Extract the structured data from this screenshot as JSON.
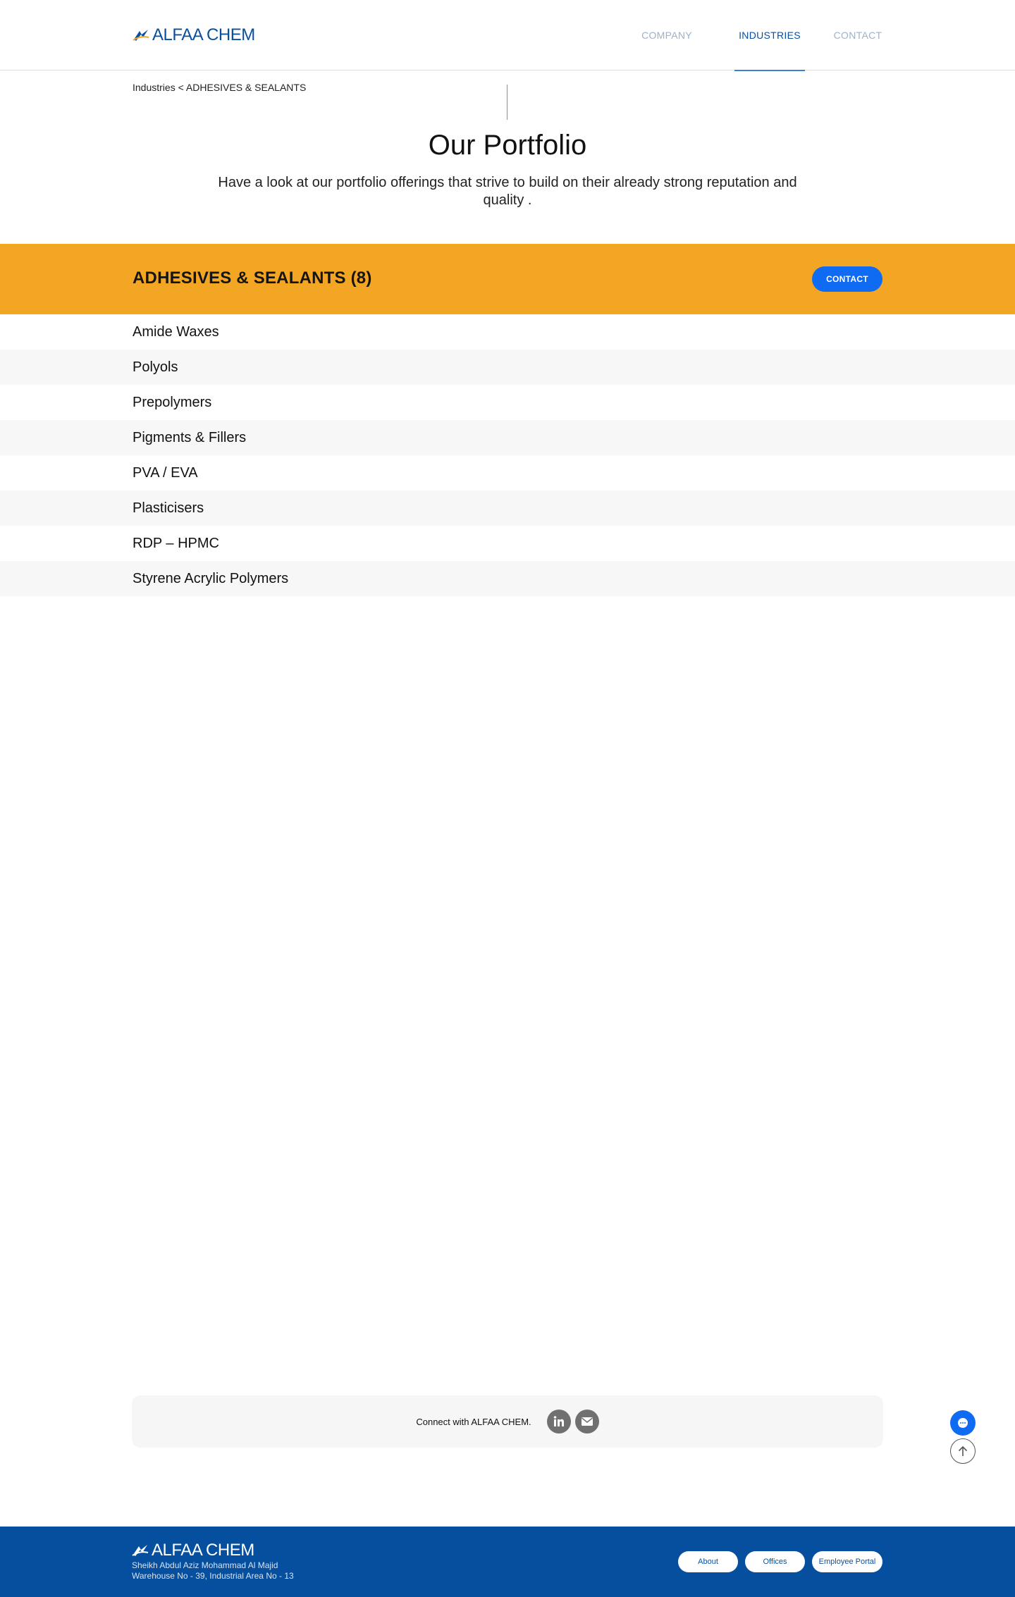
{
  "header": {
    "logo_text": "ALFAA CHEM",
    "nav": [
      {
        "label": "COMPANY"
      },
      {
        "label": "INDUSTRIES",
        "active": true
      },
      {
        "label": "CONTACT"
      }
    ]
  },
  "breadcrumb": {
    "parent": "Industries",
    "separator": " < ",
    "current": "ADHESIVES & SEALANTS"
  },
  "intro": {
    "title": "Our Portfolio",
    "subtitle": "Have a look at our portfolio offerings that strive to build on their already strong reputation and quality ."
  },
  "category": {
    "title": "ADHESIVES & SEALANTS (8)",
    "contact_label": "CONTACT"
  },
  "products": [
    "Amide Waxes",
    "Polyols",
    "Prepolymers",
    "Pigments & Fillers",
    "PVA / EVA",
    "Plasticisers",
    "RDP – HPMC",
    "Styrene Acrylic Polymers"
  ],
  "connect": {
    "text": "Connect with ALFAA CHEM.",
    "icons": [
      "linkedin-icon",
      "email-icon"
    ]
  },
  "footer": {
    "logo_text": "ALFAA CHEM",
    "address_line1": "Sheikh Abdul Aziz Mohammad Al Majid",
    "address_line2": "Warehouse No - 39, Industrial Area No - 13",
    "links": [
      "About",
      "Offices",
      "Employee Portal"
    ]
  },
  "colors": {
    "brand_blue": "#0a4f9c",
    "accent_orange": "#f2a623",
    "button_blue": "#0e6bf2",
    "footer_blue": "#064f9e"
  }
}
